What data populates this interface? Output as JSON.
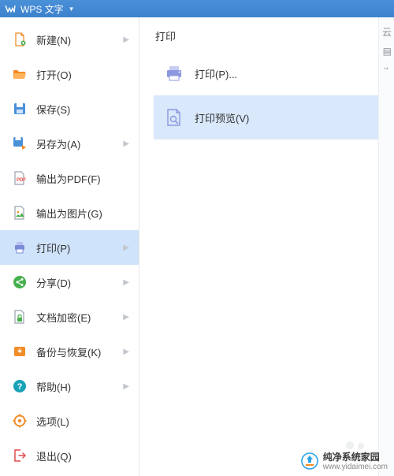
{
  "app": {
    "title": "WPS 文字"
  },
  "colors": {
    "blue": "#4a90d9",
    "orange": "#f28c28",
    "green": "#46b04a",
    "teal": "#17a2b8",
    "red": "#e24c4c",
    "gray": "#9aa2ad"
  },
  "sidebar": {
    "items": [
      {
        "label": "新建(N)",
        "icon": "new-file-icon",
        "submenu": true
      },
      {
        "label": "打开(O)",
        "icon": "open-folder-icon",
        "submenu": false
      },
      {
        "label": "保存(S)",
        "icon": "save-icon",
        "submenu": false
      },
      {
        "label": "另存为(A)",
        "icon": "save-as-icon",
        "submenu": true
      },
      {
        "label": "输出为PDF(F)",
        "icon": "export-pdf-icon",
        "submenu": false
      },
      {
        "label": "输出为图片(G)",
        "icon": "export-image-icon",
        "submenu": false
      },
      {
        "label": "打印(P)",
        "icon": "print-icon",
        "submenu": true,
        "selected": true
      },
      {
        "label": "分享(D)",
        "icon": "share-icon",
        "submenu": true
      },
      {
        "label": "文档加密(E)",
        "icon": "encrypt-icon",
        "submenu": true
      },
      {
        "label": "备份与恢复(K)",
        "icon": "backup-icon",
        "submenu": true
      },
      {
        "label": "帮助(H)",
        "icon": "help-icon",
        "submenu": true
      },
      {
        "label": "选项(L)",
        "icon": "options-icon",
        "submenu": false
      },
      {
        "label": "退出(Q)",
        "icon": "exit-icon",
        "submenu": false
      }
    ]
  },
  "panel": {
    "title": "打印",
    "items": [
      {
        "label": "打印(P)...",
        "icon": "printer-icon"
      },
      {
        "label": "打印预览(V)",
        "icon": "print-preview-icon",
        "hover": true
      }
    ]
  },
  "rightstrip": {
    "char1": "云",
    "char2": "▤",
    "char3": "↕"
  },
  "watermark": {
    "brand": "纯净系统家园",
    "url": "www.yidaimei.com"
  }
}
